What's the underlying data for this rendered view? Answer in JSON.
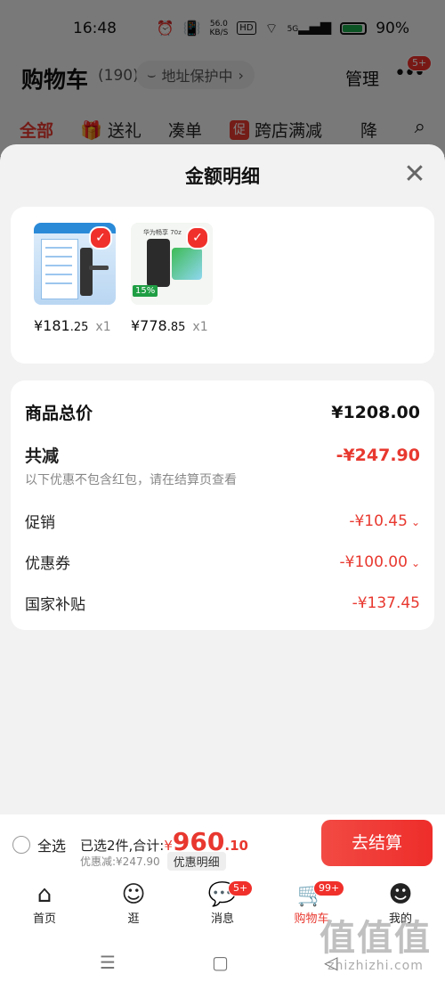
{
  "status_bar": {
    "time": "16:48",
    "net_speed_top": "56.0",
    "net_speed_bottom": "KB/S",
    "hd": "HD",
    "signal": "5G",
    "battery": "90%",
    "battery_level": 0.9
  },
  "cart_header": {
    "title": "购物车",
    "count": "(190)",
    "address_protect": "地址保护中",
    "manage": "管理",
    "more_badge": "5+"
  },
  "filter_tabs": {
    "all": "全部",
    "gift": "送礼",
    "bundle": "凑单",
    "promo_tag": "促",
    "cross_store": "跨店满减",
    "reduce": "降"
  },
  "sheet": {
    "title": "金额明细"
  },
  "products": [
    {
      "price_int": "¥181",
      "price_dec": ".25",
      "qty": "x1"
    },
    {
      "price_int": "¥778",
      "price_dec": ".85",
      "qty": "x1",
      "tag": "15%",
      "brand": "华为畅享 70z"
    }
  ],
  "details": {
    "total_label": "商品总价",
    "total_value": "¥1208.00",
    "reduce_label": "共减",
    "reduce_value": "-¥247.90",
    "reduce_note": "以下优惠不包含红包，请在结算页查看",
    "promo_label": "促销",
    "promo_value": "-¥10.45",
    "coupon_label": "优惠券",
    "coupon_value": "-¥100.00",
    "subsidy_label": "国家补贴",
    "subsidy_value": "-¥137.45"
  },
  "checkout": {
    "select_all": "全选",
    "summary_prefix": "已选2件,合计:",
    "currency": "¥",
    "amount_int": "960",
    "amount_dec": ".10",
    "discount": "优惠减:¥247.90",
    "detail_link": "优惠明细",
    "button": "去结算"
  },
  "tabbar": {
    "home": "首页",
    "browse": "逛",
    "messages": "消息",
    "messages_badge": "5+",
    "cart": "购物车",
    "cart_badge": "99+",
    "me": "我的"
  },
  "watermark": {
    "big": "值值值",
    "small": "zhizhizhi.com"
  },
  "colors": {
    "accent": "#e8382f",
    "sheet_bg": "#f2f2f2"
  }
}
